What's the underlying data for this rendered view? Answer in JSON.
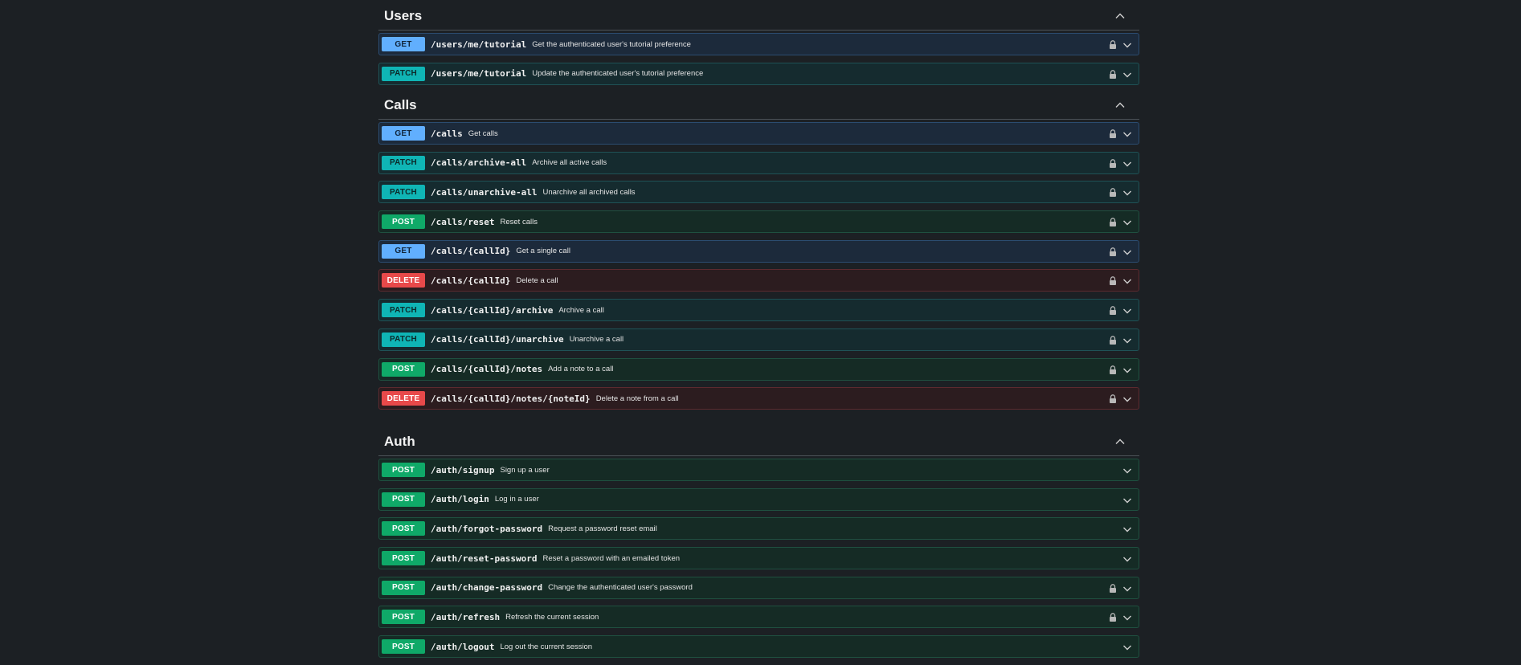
{
  "sections": [
    {
      "title": "Users",
      "ops": [
        {
          "method": "GET",
          "kind": "get",
          "path": "/users/me/tutorial",
          "desc": "Get the authenticated user's tutorial preference",
          "locked": true
        },
        {
          "method": "PATCH",
          "kind": "patch",
          "path": "/users/me/tutorial",
          "desc": "Update the authenticated user's tutorial preference",
          "locked": true
        }
      ]
    },
    {
      "title": "Calls",
      "ops": [
        {
          "method": "GET",
          "kind": "get",
          "path": "/calls",
          "desc": "Get calls",
          "locked": true
        },
        {
          "method": "PATCH",
          "kind": "patch",
          "path": "/calls/archive-all",
          "desc": "Archive all active calls",
          "locked": true
        },
        {
          "method": "PATCH",
          "kind": "patch",
          "path": "/calls/unarchive-all",
          "desc": "Unarchive all archived calls",
          "locked": true
        },
        {
          "method": "POST",
          "kind": "post",
          "path": "/calls/reset",
          "desc": "Reset calls",
          "locked": true
        },
        {
          "method": "GET",
          "kind": "get",
          "path": "/calls/{callId}",
          "desc": "Get a single call",
          "locked": true
        },
        {
          "method": "DELETE",
          "kind": "delete",
          "path": "/calls/{callId}",
          "desc": "Delete a call",
          "locked": true
        },
        {
          "method": "PATCH",
          "kind": "patch",
          "path": "/calls/{callId}/archive",
          "desc": "Archive a call",
          "locked": true
        },
        {
          "method": "PATCH",
          "kind": "patch",
          "path": "/calls/{callId}/unarchive",
          "desc": "Unarchive a call",
          "locked": true
        },
        {
          "method": "POST",
          "kind": "post",
          "path": "/calls/{callId}/notes",
          "desc": "Add a note to a call",
          "locked": true
        },
        {
          "method": "DELETE",
          "kind": "delete",
          "path": "/calls/{callId}/notes/{noteId}",
          "desc": "Delete a note from a call",
          "locked": true
        }
      ]
    },
    {
      "title": "Auth",
      "ops": [
        {
          "method": "POST",
          "kind": "post",
          "path": "/auth/signup",
          "desc": "Sign up a user",
          "locked": false
        },
        {
          "method": "POST",
          "kind": "post",
          "path": "/auth/login",
          "desc": "Log in a user",
          "locked": false
        },
        {
          "method": "POST",
          "kind": "post",
          "path": "/auth/forgot-password",
          "desc": "Request a password reset email",
          "locked": false
        },
        {
          "method": "POST",
          "kind": "post",
          "path": "/auth/reset-password",
          "desc": "Reset a password with an emailed token",
          "locked": false
        },
        {
          "method": "POST",
          "kind": "post",
          "path": "/auth/change-password",
          "desc": "Change the authenticated user's password",
          "locked": true
        },
        {
          "method": "POST",
          "kind": "post",
          "path": "/auth/refresh",
          "desc": "Refresh the current session",
          "locked": true
        },
        {
          "method": "POST",
          "kind": "post",
          "path": "/auth/logout",
          "desc": "Log out the current session",
          "locked": false
        }
      ]
    }
  ],
  "icons": {
    "collapse": "chevron-up-icon",
    "expand": "chevron-down-icon",
    "lock": "lock-icon"
  },
  "colors": {
    "background": "#1c2024",
    "get": "#61affe",
    "patch": "#0fb5b5",
    "post": "#0fa968",
    "delete": "#e8494a"
  }
}
